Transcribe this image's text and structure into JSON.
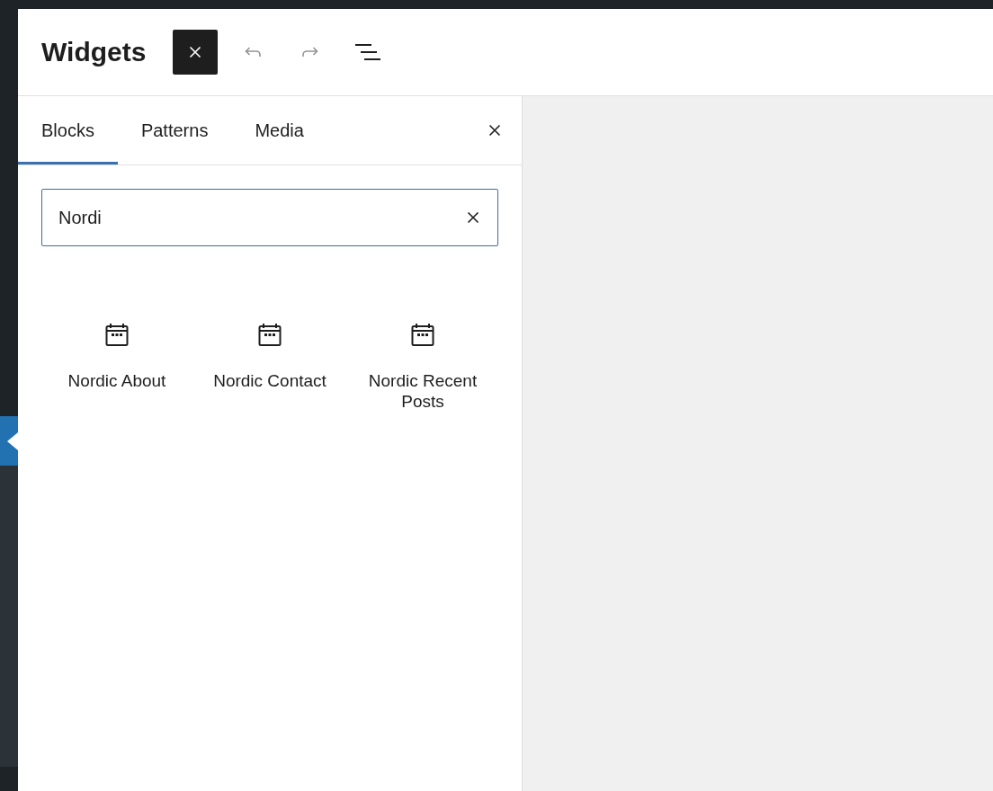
{
  "header": {
    "title": "Widgets",
    "toolbar": [
      {
        "kind": "close",
        "disabled": false
      },
      {
        "kind": "undo",
        "disabled": true
      },
      {
        "kind": "redo",
        "disabled": true
      },
      {
        "kind": "list",
        "disabled": false
      }
    ]
  },
  "inserter": {
    "tabs": [
      {
        "label": "Blocks",
        "selected": true
      },
      {
        "label": "Patterns",
        "selected": false
      },
      {
        "label": "Media",
        "selected": false
      }
    ],
    "search": {
      "value": "Nordi"
    },
    "blocks": [
      {
        "label": "Nordic About"
      },
      {
        "label": "Nordic Contact"
      },
      {
        "label": "Nordic Recent Posts"
      }
    ]
  }
}
